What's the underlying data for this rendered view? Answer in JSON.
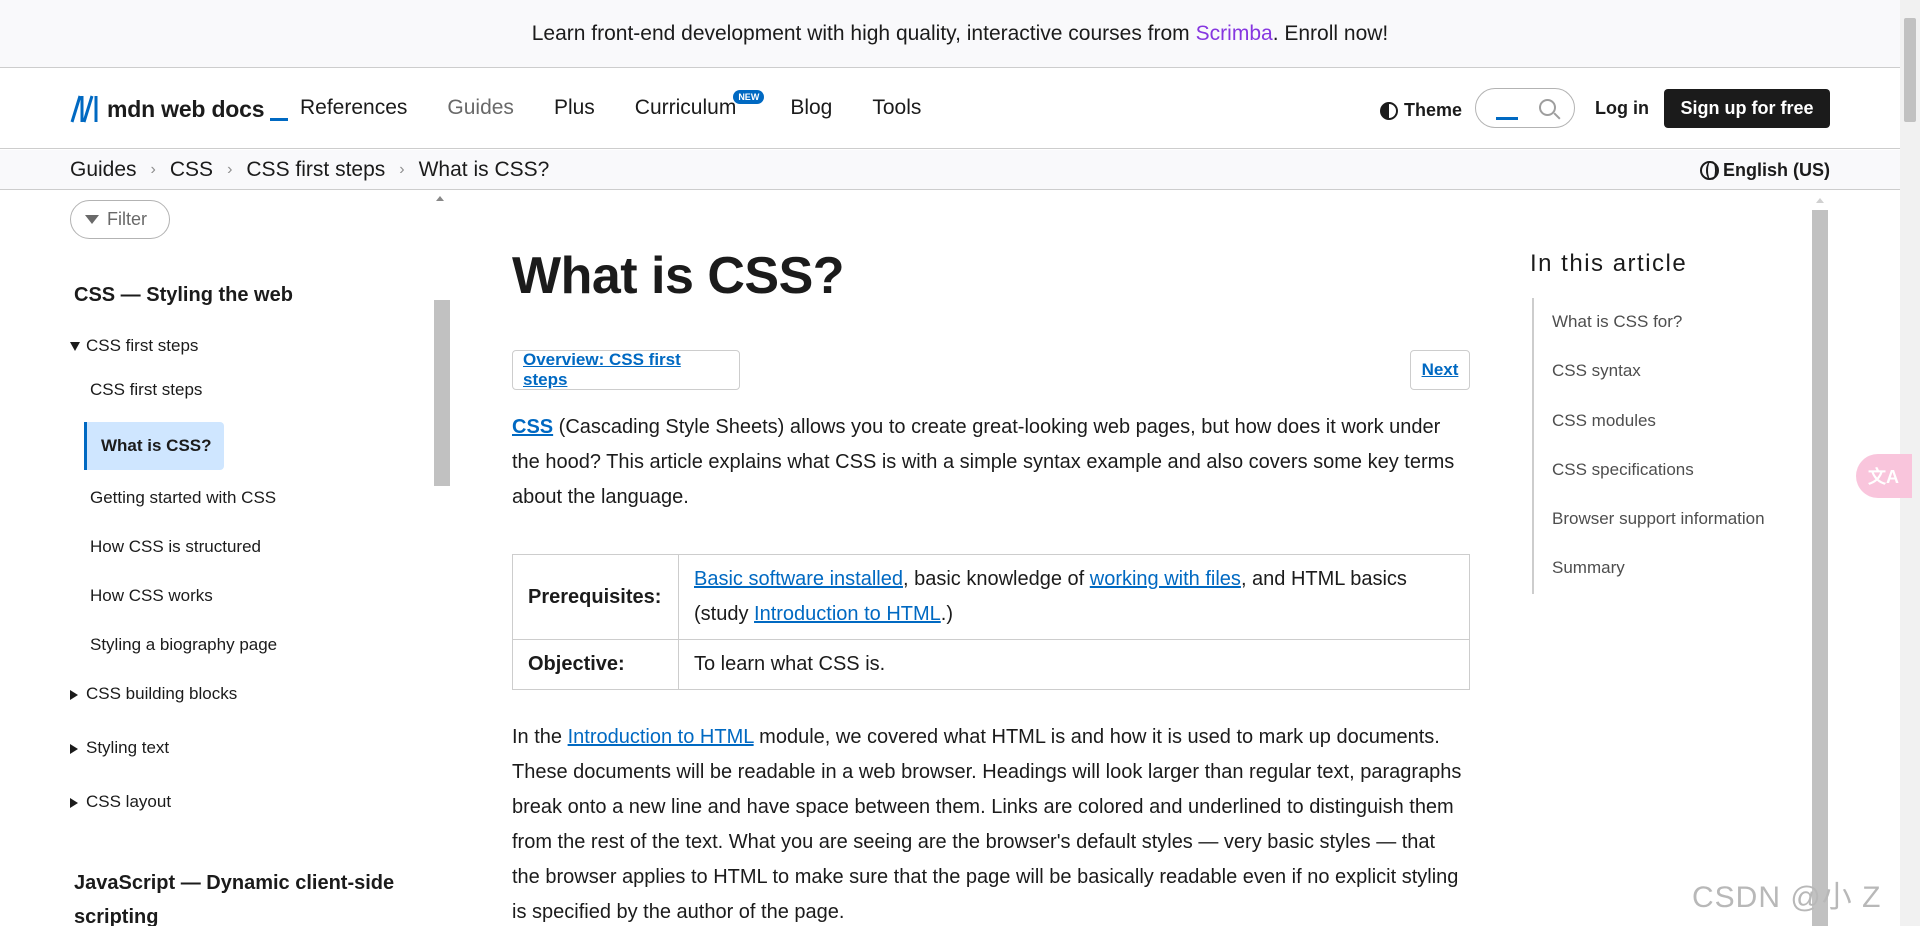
{
  "banner": {
    "text_before": "Learn front-end development with high quality, interactive courses from",
    "link": "Scrimba",
    "text_after": ". Enroll now!"
  },
  "header": {
    "logo_text": "mdn web docs",
    "nav": [
      "References",
      "Guides",
      "Plus",
      "Curriculum",
      "Blog",
      "Tools"
    ],
    "new_badge": "NEW",
    "theme_label": "Theme",
    "login_label": "Log in",
    "signup_label": "Sign up for free"
  },
  "breadcrumbs": {
    "items": [
      "Guides",
      "CSS",
      "CSS first steps",
      "What is CSS?"
    ],
    "separator": "›",
    "language": "English (US)"
  },
  "sidebar": {
    "filter_label": "Filter",
    "title": "CSS — Styling the web",
    "section": "CSS first steps",
    "items": [
      "CSS first steps",
      "What is CSS?",
      "Getting started with CSS",
      "How CSS is structured",
      "How CSS works",
      "Styling a biography page"
    ],
    "collapsed": [
      "CSS building blocks",
      "Styling text",
      "CSS layout"
    ],
    "title2": "JavaScript — Dynamic client-side scripting"
  },
  "main": {
    "title": "What is CSS?",
    "overview_button": "Overview: CSS first steps",
    "next_button": "Next",
    "intro": {
      "link": "CSS",
      "text": " (Cascading Style Sheets) allows you to create great-looking web pages, but how does it work under the hood? This article explains what CSS is with a simple syntax example and also covers some key terms about the language."
    },
    "table": {
      "prereq_label": "Prerequisites:",
      "prereq_link1": "Basic software installed",
      "prereq_text1": ", basic knowledge of ",
      "prereq_link2": "working with files",
      "prereq_text2": ", and HTML basics (study ",
      "prereq_link3": "Introduction to HTML",
      "prereq_text3": ".)",
      "objective_label": "Objective:",
      "objective_text": "To learn what CSS is."
    },
    "para2": {
      "text_before": "In the ",
      "link": "Introduction to HTML",
      "text_after": " module, we covered what HTML is and how it is used to mark up documents. These documents will be readable in a web browser. Headings will look larger than regular text, paragraphs break onto a new line and have space between them. Links are colored and underlined to distinguish them from the rest of the text. What you are seeing are the browser's default styles — very basic styles — that the browser applies to HTML to make sure that the page will be basically readable even if no explicit styling is specified by the author of the page."
    }
  },
  "toc": {
    "title": "In this article",
    "items": [
      "What is CSS for?",
      "CSS syntax",
      "CSS modules",
      "CSS specifications",
      "Browser support information",
      "Summary"
    ]
  },
  "float_button": "文A",
  "watermark": "CSDN @小 Z",
  "colors": {
    "accent": "#0069c2",
    "banner_link": "#8636e0",
    "active_bg": "#cfe6ff"
  }
}
